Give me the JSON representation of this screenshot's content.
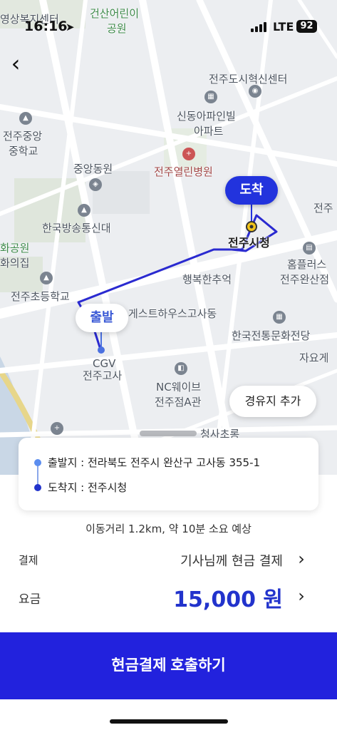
{
  "status_bar": {
    "time": "16:16",
    "network": "LTE",
    "battery": "92"
  },
  "map": {
    "labels": [
      {
        "id": "l1",
        "text": "건산어린이"
      },
      {
        "id": "l2",
        "text": "공원"
      },
      {
        "id": "l3",
        "text": "영상복지센터"
      },
      {
        "id": "l4",
        "text": "전주도시혁신센터"
      },
      {
        "id": "l5",
        "text": "신동아파인빌"
      },
      {
        "id": "l6",
        "text": "아파트"
      },
      {
        "id": "l7",
        "text": "전주중앙"
      },
      {
        "id": "l8",
        "text": "중학교"
      },
      {
        "id": "l9",
        "text": "중앙동원"
      },
      {
        "id": "l10",
        "text": "전주열린병원"
      },
      {
        "id": "l11",
        "text": "한국방송통신대"
      },
      {
        "id": "l12",
        "text": "화공원"
      },
      {
        "id": "l13",
        "text": "화의집"
      },
      {
        "id": "l14",
        "text": "전주시청"
      },
      {
        "id": "l15",
        "text": "행복한추억"
      },
      {
        "id": "l16",
        "text": "홈플러스"
      },
      {
        "id": "l17",
        "text": "전주완산점"
      },
      {
        "id": "l18",
        "text": "전주초등학교"
      },
      {
        "id": "l19",
        "text": "게스트하우스고사동"
      },
      {
        "id": "l20",
        "text": "한국전통문화전당"
      },
      {
        "id": "l21",
        "text": "CGV"
      },
      {
        "id": "l22",
        "text": "전주고사"
      },
      {
        "id": "l23",
        "text": "NC웨이브"
      },
      {
        "id": "l24",
        "text": "전주점A관"
      },
      {
        "id": "l25",
        "text": "자요게"
      },
      {
        "id": "l26",
        "text": "전주"
      },
      {
        "id": "l27",
        "text": "청사초롱"
      }
    ],
    "destination_pin": "도착",
    "origin_pin": "출발",
    "waypoint_button": "경유지 추가"
  },
  "route": {
    "origin": "출발지 : 전라북도 전주시 완산구 고사동 355-1",
    "destination": "도착지 : 전주시청"
  },
  "trip_info": "이동거리 1.2km, 약 10분 소요 예상",
  "payment": {
    "label": "결제",
    "value": "기사님께 현금 결제"
  },
  "fare": {
    "label": "요금",
    "value": "15,000 원"
  },
  "cta_label": "현금결제 호출하기",
  "colors": {
    "brand": "#2222dd",
    "route_line": "#2a2ad0",
    "origin_dot": "#5b8def",
    "map_bg": "#eef0f2"
  }
}
